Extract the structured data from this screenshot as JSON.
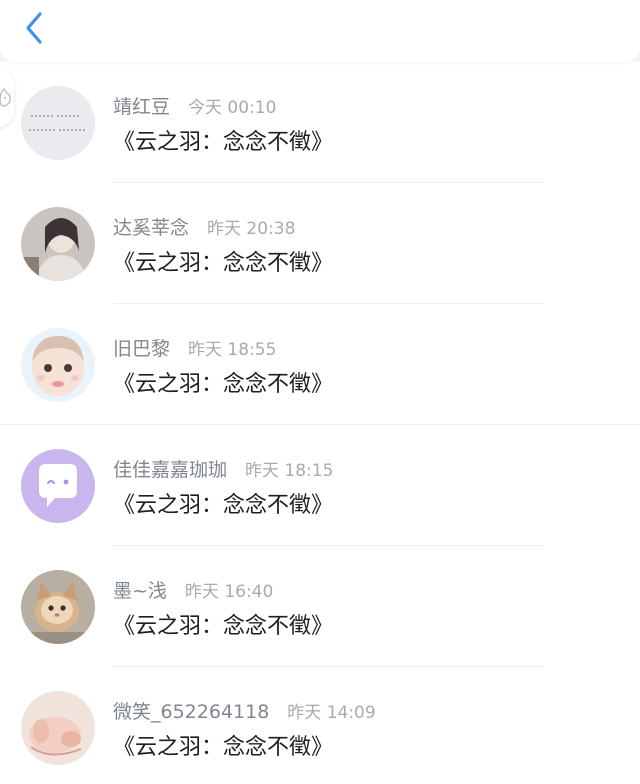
{
  "header": {
    "back_icon": "chevron-left-icon",
    "accent_color": "#3d8ef0"
  },
  "messages": [
    {
      "name": "靖红豆",
      "time": "今天 00:10",
      "text": "《云之羽：念念不徵》"
    },
    {
      "name": "达奚莘念",
      "time": "昨天 20:38",
      "text": "《云之羽：念念不徵》"
    },
    {
      "name": "旧巴黎",
      "time": "昨天 18:55",
      "text": "《云之羽：念念不徵》"
    },
    {
      "name": "佳佳嘉嘉珈珈",
      "time": "昨天 18:15",
      "text": "《云之羽：念念不徵》"
    },
    {
      "name": "墨~浅",
      "time": "昨天 16:40",
      "text": "《云之羽：念念不徵》"
    },
    {
      "name": "微笑_652264118",
      "time": "昨天 14:09",
      "text": "《云之羽：念念不徵》"
    }
  ]
}
